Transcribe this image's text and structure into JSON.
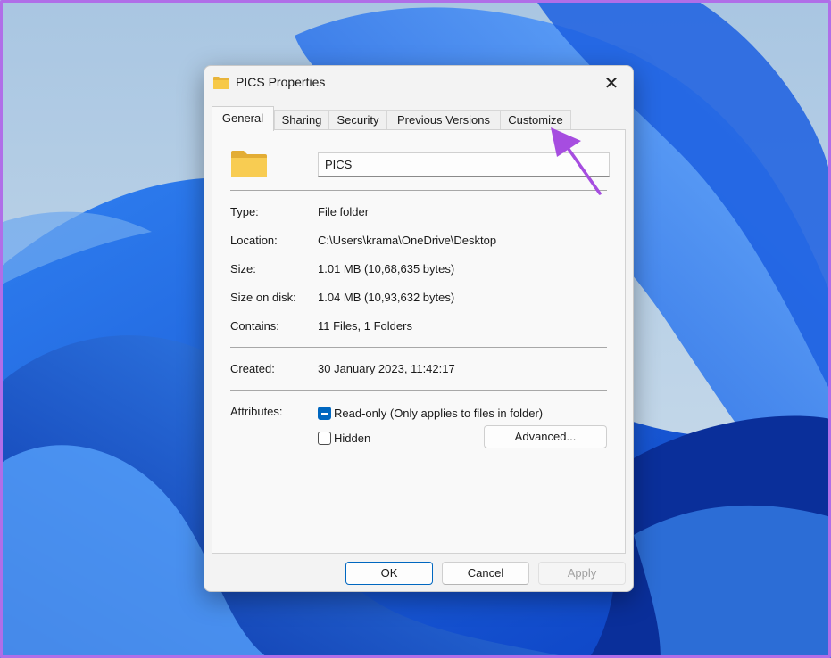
{
  "window": {
    "title": "PICS Properties",
    "close_glyph": "✕"
  },
  "tabs": [
    {
      "label": "General",
      "active": true
    },
    {
      "label": "Sharing",
      "active": false
    },
    {
      "label": "Security",
      "active": false
    },
    {
      "label": "Previous Versions",
      "active": false
    },
    {
      "label": "Customize",
      "active": false
    }
  ],
  "general": {
    "folder_name": "PICS",
    "properties": [
      {
        "label": "Type:",
        "value": "File folder"
      },
      {
        "label": "Location:",
        "value": "C:\\Users\\krama\\OneDrive\\Desktop"
      },
      {
        "label": "Size:",
        "value": "1.01 MB (10,68,635 bytes)"
      },
      {
        "label": "Size on disk:",
        "value": "1.04 MB (10,93,632 bytes)"
      },
      {
        "label": "Contains:",
        "value": "11 Files, 1 Folders"
      }
    ],
    "created": {
      "label": "Created:",
      "value": "30 January 2023, 11:42:17"
    },
    "attributes": {
      "label": "Attributes:",
      "readonly": {
        "label": "Read-only (Only applies to files in folder)",
        "state": "indeterminate"
      },
      "hidden": {
        "label": "Hidden",
        "state": "unchecked"
      },
      "advanced_label": "Advanced..."
    }
  },
  "buttons": {
    "ok": "OK",
    "cancel": "Cancel",
    "apply": "Apply"
  },
  "colors": {
    "accent": "#0067c0",
    "annotation_arrow": "#a64de0",
    "folder_yellow": "#f7c948"
  },
  "icons": {
    "title": "folder-icon",
    "large": "folder-icon",
    "close": "close-icon",
    "annotation": "arrow-icon"
  }
}
